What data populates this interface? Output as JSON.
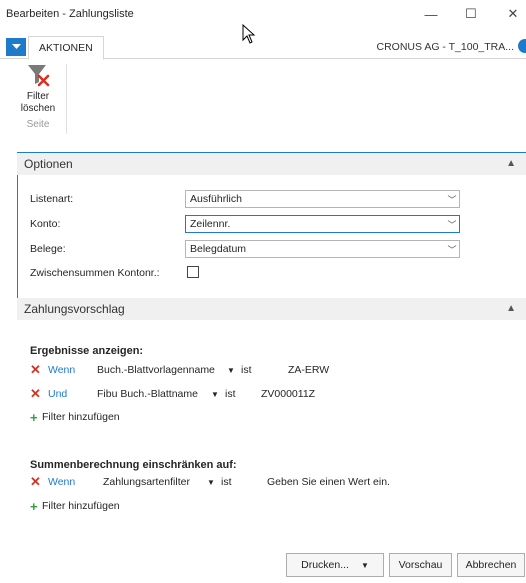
{
  "window": {
    "title": "Bearbeiten - Zahlungsliste",
    "minimize": "—",
    "maximize": "☐",
    "close": "✕"
  },
  "ribbon": {
    "tab": "AKTIONEN",
    "company": "CRONUS AG - T_100_TRA...",
    "filter_line1": "Filter",
    "filter_line2": "löschen",
    "group": "Seite"
  },
  "options": {
    "header": "Optionen",
    "fields": [
      {
        "label": "Listenart:",
        "value": "Ausführlich"
      },
      {
        "label": "Konto:",
        "value": "Zeilennr."
      },
      {
        "label": "Belege:",
        "value": "Belegdatum"
      }
    ],
    "subtotal_label": "Zwischensummen Kontonr.:",
    "subtotal_checked": false
  },
  "proposal": {
    "header": "Zahlungsvorschlag",
    "results_heading": "Ergebnisse anzeigen:",
    "filters": [
      {
        "keyword": "Wenn",
        "field": "Buch.-Blattvorlagenname",
        "op": "ist",
        "value": "ZA-ERW"
      },
      {
        "keyword": "Und",
        "field": "Fibu Buch.-Blattname",
        "op": "ist",
        "value": "ZV000011Z"
      }
    ],
    "add_filter": "Filter hinzufügen",
    "sum_heading": "Summenberechnung einschränken auf:",
    "sum_filter": {
      "keyword": "Wenn",
      "field": "Zahlungsartenfilter",
      "op": "ist",
      "value": "Geben Sie einen Wert ein."
    },
    "add_filter2": "Filter hinzufügen"
  },
  "buttons": {
    "print": "Drucken...",
    "preview": "Vorschau",
    "cancel": "Abbrechen"
  },
  "colors": {
    "accent": "#1e7acb",
    "remove": "#d6331f",
    "add": "#2aa33a"
  }
}
